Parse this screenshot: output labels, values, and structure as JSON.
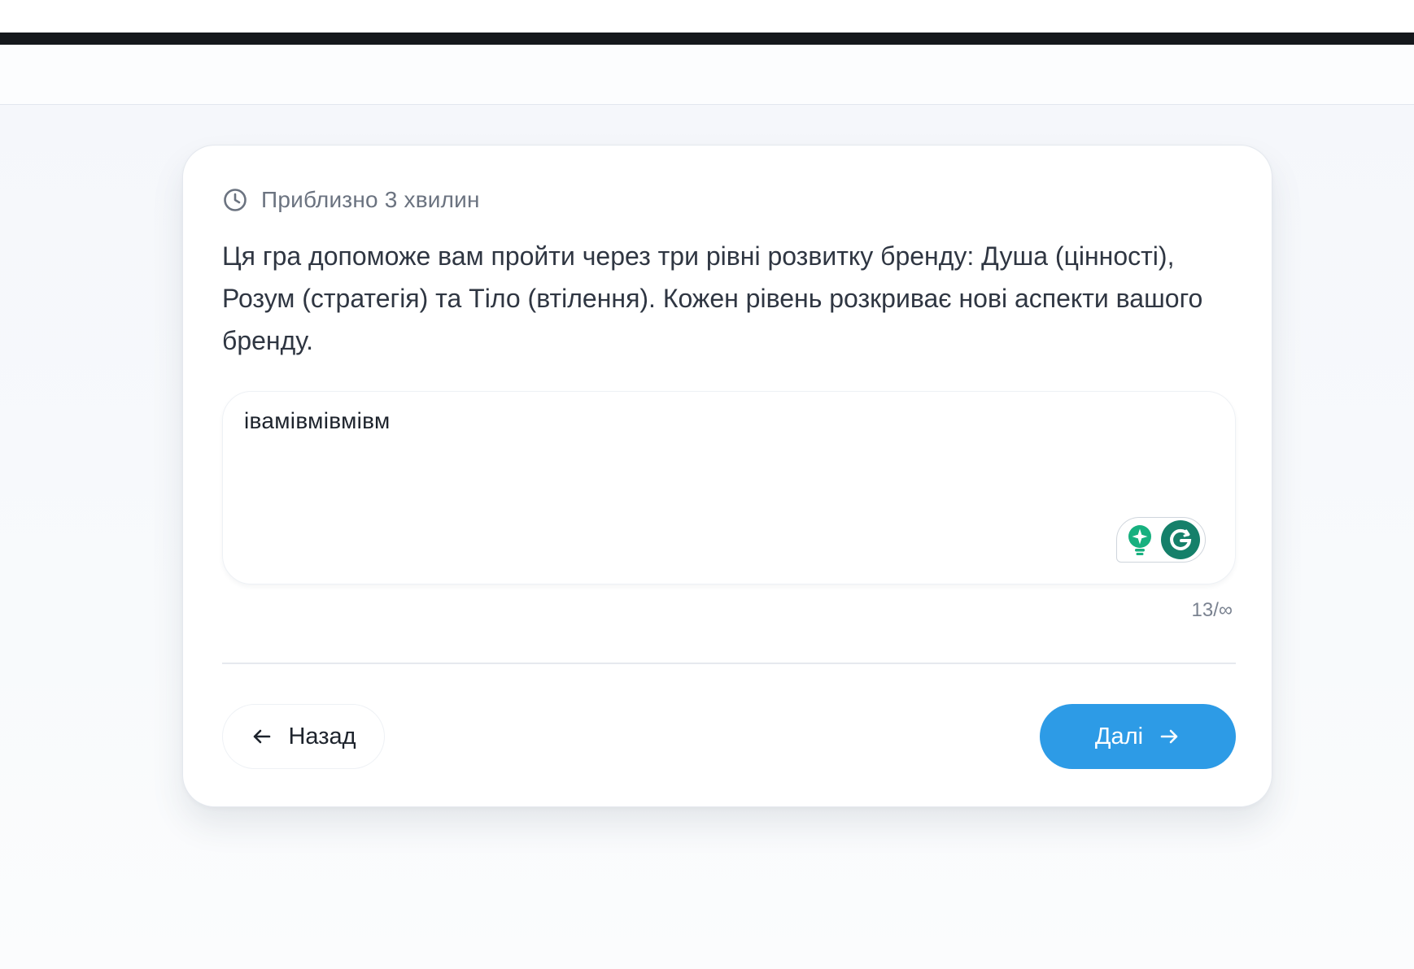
{
  "card": {
    "duration_text": "Приблизно 3 хвилин",
    "description": "Ця гра допоможе вам пройти через три рівні розвитку бренду: Душа (цінності), Розум (стратегія) та Тіло (втілення). Кожен рівень розкриває нові аспекти вашого бренду.",
    "answer": {
      "value": "івамівмівмівм",
      "char_counter": "13/∞"
    },
    "back_button_label": "Назад",
    "next_button_label": "Далі"
  },
  "icons": {
    "duration": "clock-icon",
    "back": "arrow-left-icon",
    "next": "arrow-right-icon",
    "assistant_suggestions": "lightbulb-icon",
    "assistant": "grammarly-icon"
  },
  "colors": {
    "top_bar": "#15181c",
    "primary": "#2d9be6",
    "grammarly_green": "#15806a",
    "text_dark": "#2f3642",
    "text_muted": "#6b7380"
  }
}
